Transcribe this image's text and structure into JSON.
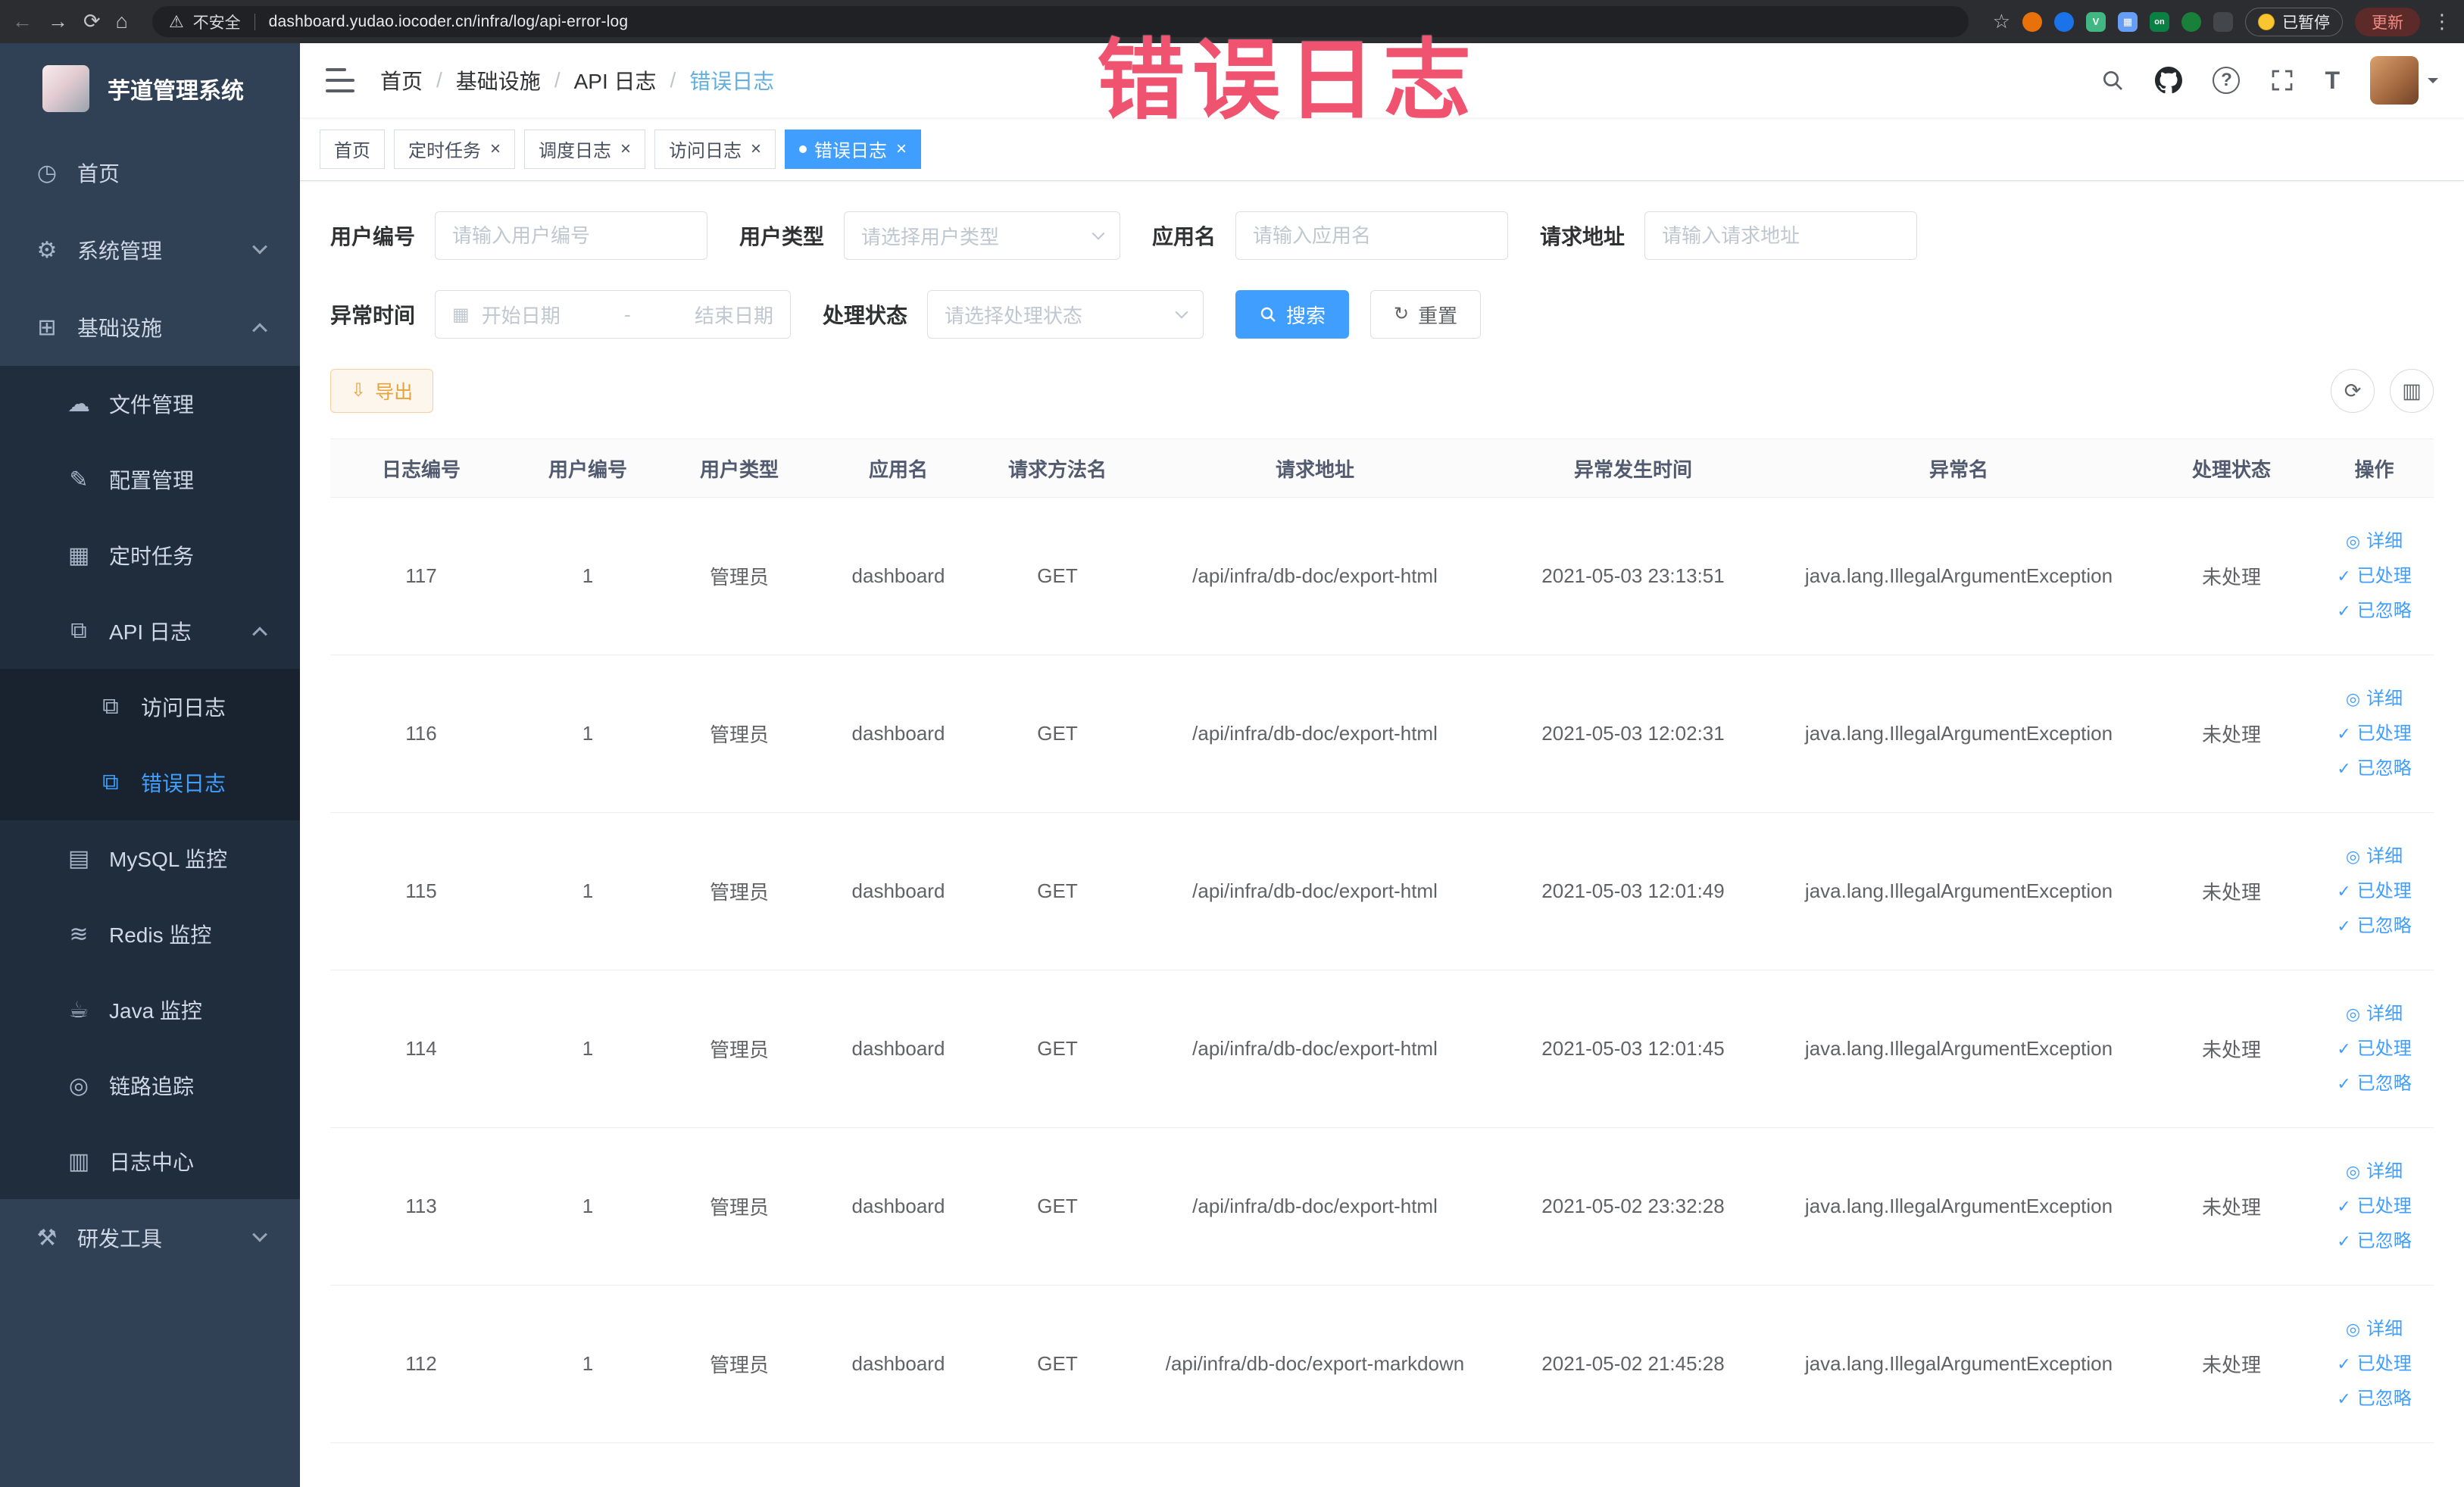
{
  "browser": {
    "security_label": "不安全",
    "url": "dashboard.yudao.iocoder.cn/infra/log/api-error-log",
    "paused_label": "已暂停",
    "update_label": "更新"
  },
  "annotation": {
    "text": "错误日志"
  },
  "sidebar": {
    "logo_title": "芋道管理系统",
    "items": [
      {
        "key": "home",
        "label": "首页",
        "icon": "dashboard-icon",
        "level": 0
      },
      {
        "key": "system",
        "label": "系统管理",
        "icon": "gear-icon",
        "level": 0,
        "arrow": "down"
      },
      {
        "key": "infra",
        "label": "基础设施",
        "icon": "infra-icon",
        "level": 0,
        "arrow": "up"
      },
      {
        "key": "file-manage",
        "label": "文件管理",
        "icon": "cloud-icon",
        "level": 1
      },
      {
        "key": "config-manage",
        "label": "配置管理",
        "icon": "edit-icon",
        "level": 1
      },
      {
        "key": "scheduled-jobs",
        "label": "定时任务",
        "icon": "list-icon",
        "level": 1
      },
      {
        "key": "api-log",
        "label": "API 日志",
        "icon": "log-icon",
        "level": 1,
        "arrow": "up"
      },
      {
        "key": "access-log",
        "label": "访问日志",
        "icon": "doc-icon",
        "level": 2
      },
      {
        "key": "error-log",
        "label": "错误日志",
        "icon": "doc-icon",
        "level": 2,
        "active": true
      },
      {
        "key": "mysql-monitor",
        "label": "MySQL 监控",
        "icon": "table-icon",
        "level": 1
      },
      {
        "key": "redis-monitor",
        "label": "Redis 监控",
        "icon": "layers-icon",
        "level": 1
      },
      {
        "key": "java-monitor",
        "label": "Java 监控",
        "icon": "coffee-icon",
        "level": 1
      },
      {
        "key": "trace",
        "label": "链路追踪",
        "icon": "eye-icon",
        "level": 1
      },
      {
        "key": "log-center",
        "label": "日志中心",
        "icon": "doc2-icon",
        "level": 1
      },
      {
        "key": "dev-tools",
        "label": "研发工具",
        "icon": "tools-icon",
        "level": 0,
        "arrow": "down"
      }
    ]
  },
  "header": {
    "breadcrumb": [
      "首页",
      "基础设施",
      "API 日志",
      "错误日志"
    ]
  },
  "tabs": [
    {
      "label": "首页",
      "closable": false,
      "active": false
    },
    {
      "label": "定时任务",
      "closable": true,
      "active": false
    },
    {
      "label": "调度日志",
      "closable": true,
      "active": false
    },
    {
      "label": "访问日志",
      "closable": true,
      "active": false
    },
    {
      "label": "错误日志",
      "closable": true,
      "active": true
    }
  ],
  "filters": {
    "user_id": {
      "label": "用户编号",
      "placeholder": "请输入用户编号"
    },
    "user_type": {
      "label": "用户类型",
      "placeholder": "请选择用户类型"
    },
    "app_name": {
      "label": "应用名",
      "placeholder": "请输入应用名"
    },
    "request_url": {
      "label": "请求地址",
      "placeholder": "请输入请求地址"
    },
    "exception_time": {
      "label": "异常时间",
      "start_placeholder": "开始日期",
      "separator": "-",
      "end_placeholder": "结束日期"
    },
    "status": {
      "label": "处理状态",
      "placeholder": "请选择处理状态"
    },
    "search_label": "搜索",
    "reset_label": "重置"
  },
  "toolbar": {
    "export_label": "导出"
  },
  "table": {
    "columns": [
      "日志编号",
      "用户编号",
      "用户类型",
      "应用名",
      "请求方法名",
      "请求地址",
      "异常发生时间",
      "异常名",
      "处理状态",
      "操作"
    ],
    "rows": [
      {
        "id": "117",
        "user_id": "1",
        "user_type": "管理员",
        "app": "dashboard",
        "method": "GET",
        "url": "/api/infra/db-doc/export-html",
        "time": "2021-05-03 23:13:51",
        "exception": "java.lang.IllegalArgumentException",
        "status": "未处理"
      },
      {
        "id": "116",
        "user_id": "1",
        "user_type": "管理员",
        "app": "dashboard",
        "method": "GET",
        "url": "/api/infra/db-doc/export-html",
        "time": "2021-05-03 12:02:31",
        "exception": "java.lang.IllegalArgumentException",
        "status": "未处理"
      },
      {
        "id": "115",
        "user_id": "1",
        "user_type": "管理员",
        "app": "dashboard",
        "method": "GET",
        "url": "/api/infra/db-doc/export-html",
        "time": "2021-05-03 12:01:49",
        "exception": "java.lang.IllegalArgumentException",
        "status": "未处理"
      },
      {
        "id": "114",
        "user_id": "1",
        "user_type": "管理员",
        "app": "dashboard",
        "method": "GET",
        "url": "/api/infra/db-doc/export-html",
        "time": "2021-05-03 12:01:45",
        "exception": "java.lang.IllegalArgumentException",
        "status": "未处理"
      },
      {
        "id": "113",
        "user_id": "1",
        "user_type": "管理员",
        "app": "dashboard",
        "method": "GET",
        "url": "/api/infra/db-doc/export-html",
        "time": "2021-05-02 23:32:28",
        "exception": "java.lang.IllegalArgumentException",
        "status": "未处理"
      },
      {
        "id": "112",
        "user_id": "1",
        "user_type": "管理员",
        "app": "dashboard",
        "method": "GET",
        "url": "/api/infra/db-doc/export-markdown",
        "time": "2021-05-02 21:45:28",
        "exception": "java.lang.IllegalArgumentException",
        "status": "未处理"
      }
    ],
    "ops": {
      "detail": "详细",
      "processed": "已处理",
      "ignored": "已忽略"
    }
  },
  "colors": {
    "accent": "#409eff",
    "sidebar_bg": "#304156",
    "warning": "#e6a23c",
    "annotation": "#ef536f"
  }
}
